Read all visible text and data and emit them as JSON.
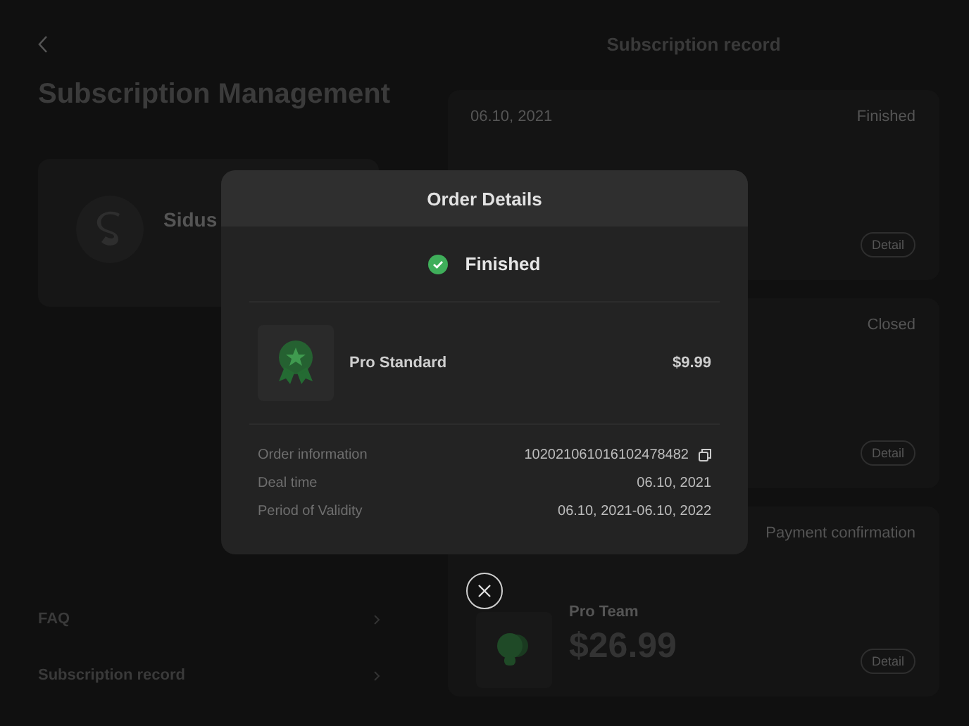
{
  "page_title": "Subscription Management",
  "account_card": {
    "name": "Sidus"
  },
  "menu": [
    {
      "label": "FAQ"
    },
    {
      "label": "Subscription record"
    }
  ],
  "record_panel": {
    "title": "Subscription record",
    "records": [
      {
        "date": "06.10, 2021",
        "status": "Finished",
        "button": "Detail"
      },
      {
        "status": "Closed",
        "button": "Detail"
      },
      {
        "status": "Payment confirmation",
        "plan": "Pro Team",
        "price": "$26.99",
        "button": "Detail"
      }
    ]
  },
  "dialog": {
    "title": "Order Details",
    "status": {
      "label": "Finished",
      "kind": "success"
    },
    "product": {
      "name": "Pro Standard",
      "price": "$9.99"
    },
    "details": [
      {
        "label": "Order information",
        "value": "102021061016102478482",
        "copyable": true
      },
      {
        "label": "Deal time",
        "value": "06.10, 2021",
        "copyable": false
      },
      {
        "label": "Period of Validity",
        "value": "06.10, 2021-06.10, 2022",
        "copyable": false
      }
    ]
  }
}
